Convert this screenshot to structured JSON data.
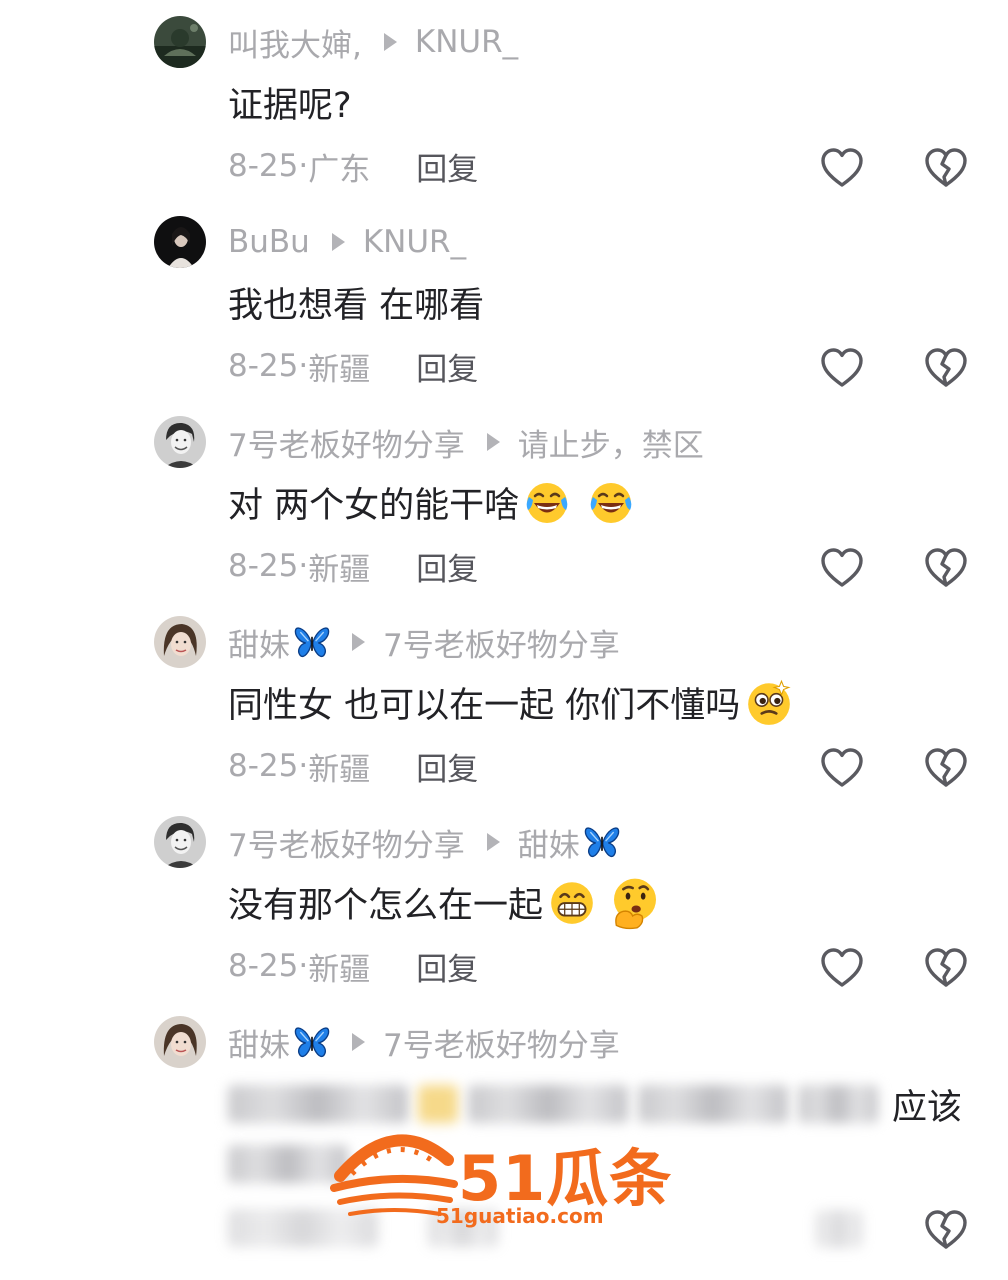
{
  "comments": [
    {
      "user": "叫我大婶,",
      "reply_to": "KNUR_",
      "text": "证据呢?",
      "date": "8-25·",
      "location": "广东",
      "reply_label": "回复"
    },
    {
      "user": "BuBu",
      "reply_to": "KNUR_",
      "text": "我也想看 在哪看",
      "date": "8-25·",
      "location": "新疆",
      "reply_label": "回复"
    },
    {
      "user": "7号老板好物分享",
      "reply_to": "请止步，禁区",
      "text": "对  两个女的能干啥",
      "emojis": [
        "laughing-crying-emoji",
        "laughing-crying-emoji"
      ],
      "date": "8-25·",
      "location": "新疆",
      "reply_label": "回复"
    },
    {
      "user": "甜妹",
      "user_icon": "butterfly-icon",
      "reply_to": "7号老板好物分享",
      "text": "同性女 也可以在一起 你们不懂吗",
      "emojis": [
        "dizzy-face-emoji"
      ],
      "date": "8-25·",
      "location": "新疆",
      "reply_label": "回复"
    },
    {
      "user": "7号老板好物分享",
      "reply_to": "甜妹",
      "reply_to_icon": "butterfly-icon",
      "text": "没有那个怎么在一起",
      "emojis": [
        "grinning-teeth-emoji",
        "thinking-face-emoji"
      ],
      "date": "8-25·",
      "location": "新疆",
      "reply_label": "回复"
    },
    {
      "user": "甜妹",
      "user_icon": "butterfly-icon",
      "reply_to": "7号老板好物分享",
      "text_visible_end": "应该",
      "text_blurred": true
    }
  ],
  "icons": {
    "like": "heart-outline-icon",
    "dislike": "broken-heart-icon"
  },
  "colors": {
    "meta_text": "#a9a9ad",
    "body_text": "#222226",
    "reply_text": "#56565c",
    "watermark": "#f26b1d"
  },
  "watermark": {
    "brand": "51瓜条",
    "url": "51guatiao.com"
  }
}
